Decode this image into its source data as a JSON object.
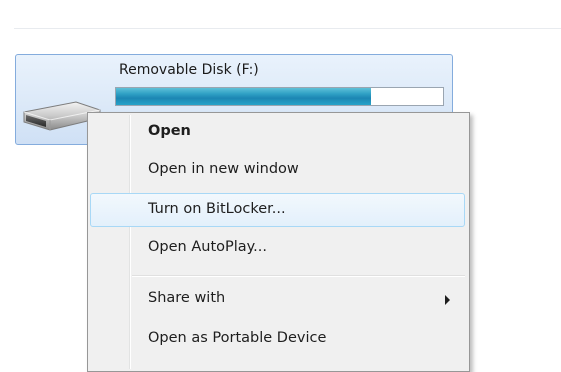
{
  "drive": {
    "name": "Removable Disk (F:)",
    "used_fraction": 0.78,
    "icon": "usb-drive-icon",
    "fill_color": "#1c86b3"
  },
  "context_menu": {
    "items": [
      {
        "label": "Open",
        "bold": true,
        "highlighted": false,
        "submenu": false
      },
      {
        "label": "Open in new window",
        "bold": false,
        "highlighted": false,
        "submenu": false
      },
      {
        "label": "Turn on BitLocker...",
        "bold": false,
        "highlighted": true,
        "submenu": false
      },
      {
        "label": "Open AutoPlay...",
        "bold": false,
        "highlighted": false,
        "submenu": false
      },
      {
        "label": "Share with",
        "bold": false,
        "highlighted": false,
        "submenu": true
      },
      {
        "label": "Open as Portable Device",
        "bold": false,
        "highlighted": false,
        "submenu": false
      }
    ],
    "highlight_color": "#a8d8f6"
  }
}
